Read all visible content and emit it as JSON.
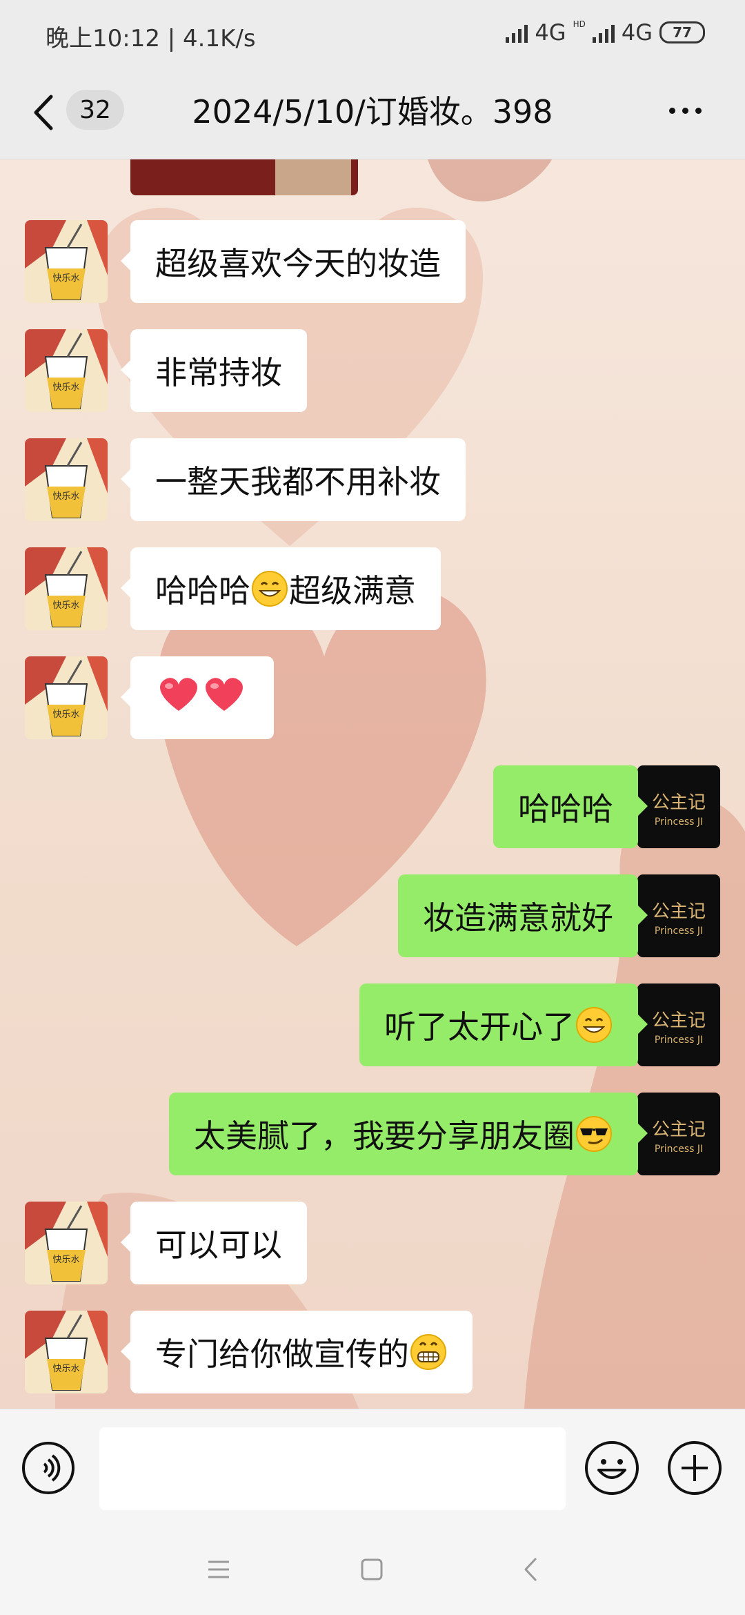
{
  "status_bar": {
    "time_speed": "晚上10:12 | 4.1K/s",
    "network1": "4G",
    "network2": "4G",
    "hd_label": "HD",
    "battery": "77"
  },
  "header": {
    "unread_count": "32",
    "title": "2024/5/10/订婚妆。398"
  },
  "messages": [
    {
      "side": "in",
      "text": "超级喜欢今天的妆造"
    },
    {
      "side": "in",
      "text": "非常持妆"
    },
    {
      "side": "in",
      "text": "一整天我都不用补妆"
    },
    {
      "side": "in",
      "text": "哈哈哈",
      "emoji": "grinning-emoji",
      "text_after": "超级满意"
    },
    {
      "side": "in",
      "emoji": "two-hearts-emoji"
    },
    {
      "side": "out",
      "text": "哈哈哈"
    },
    {
      "side": "out",
      "text": "妆造满意就好"
    },
    {
      "side": "out",
      "text": "听了太开心了",
      "emoji": "grinning-emoji"
    },
    {
      "side": "out",
      "text": "太美腻了，我要分享朋友圈",
      "emoji": "smirk-sunglasses-emoji"
    },
    {
      "side": "in",
      "text": "可以可以"
    },
    {
      "side": "in",
      "text": "专门给你做宣传的",
      "emoji": "grimacing-emoji"
    }
  ],
  "avatars": {
    "contact_label": "快乐水",
    "self_brand_cn": "公主记",
    "self_brand_en": "Princess JI"
  },
  "input": {
    "placeholder": "",
    "value": ""
  },
  "colors": {
    "outgoing_bubble": "#95ec69",
    "incoming_bubble": "#ffffff",
    "header_bg": "#ececec"
  }
}
